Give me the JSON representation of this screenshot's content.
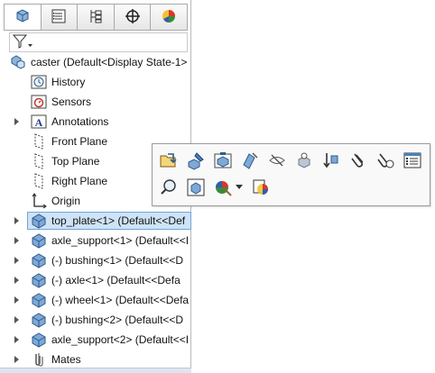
{
  "tabs": [
    {
      "name": "featuremanager",
      "icon": "featuremanager-tree-icon"
    },
    {
      "name": "propertymanager",
      "icon": "propertymanager-icon"
    },
    {
      "name": "configurationmanager",
      "icon": "configurationmanager-icon"
    },
    {
      "name": "dimxpertmanager",
      "icon": "dimxpert-crosshair-icon"
    },
    {
      "name": "displaymanager",
      "icon": "displaymanager-pie-icon"
    }
  ],
  "filter": {
    "icon": "filter-funnel-icon"
  },
  "tree": {
    "root_label": "caster  (Default<Display State-1>",
    "items": [
      {
        "label": "History",
        "icon": "history-icon",
        "expandable": false
      },
      {
        "label": "Sensors",
        "icon": "sensors-icon",
        "expandable": false
      },
      {
        "label": "Annotations",
        "icon": "annotations-icon",
        "expandable": true
      },
      {
        "label": "Front Plane",
        "icon": "plane-icon",
        "expandable": false
      },
      {
        "label": "Top Plane",
        "icon": "plane-icon",
        "expandable": false
      },
      {
        "label": "Right Plane",
        "icon": "plane-icon",
        "expandable": false
      },
      {
        "label": "Origin",
        "icon": "origin-icon",
        "expandable": false
      },
      {
        "label": "top_plate<1> (Default<<Def",
        "icon": "part-icon",
        "expandable": true,
        "selected": true
      },
      {
        "label": "axle_support<1> (Default<<I",
        "icon": "part-icon",
        "expandable": true
      },
      {
        "label": "(-) bushing<1> (Default<<D",
        "icon": "part-icon",
        "expandable": true
      },
      {
        "label": "(-) axle<1> (Default<<Defa",
        "icon": "part-icon",
        "expandable": true
      },
      {
        "label": "(-) wheel<1> (Default<<Defa",
        "icon": "part-icon",
        "expandable": true
      },
      {
        "label": "(-) bushing<2> (Default<<D",
        "icon": "part-icon",
        "expandable": true
      },
      {
        "label": "axle_support<2> (Default<<I",
        "icon": "part-icon",
        "expandable": true
      },
      {
        "label": "Mates",
        "icon": "mates-icon",
        "expandable": true
      }
    ]
  },
  "context_toolbar": {
    "row1": [
      "open-part-icon",
      "edit-part-icon",
      "replace-component-icon",
      "smart-dimension-icon",
      "hide-component-icon",
      "isolate-icon",
      "fix-component-icon",
      "paperclip-icon",
      "view-mates-icon",
      "properties-list-icon"
    ],
    "row2": [
      "zoom-to-selection-icon",
      "component-properties-icon",
      "appearance-icon",
      "appearance-dropdown-icon",
      "change-transparency-icon"
    ]
  },
  "colors": {
    "selection_fill": "#cfe3f6",
    "selection_border": "#6ea6d8",
    "part_blue": "#3a78b8"
  }
}
